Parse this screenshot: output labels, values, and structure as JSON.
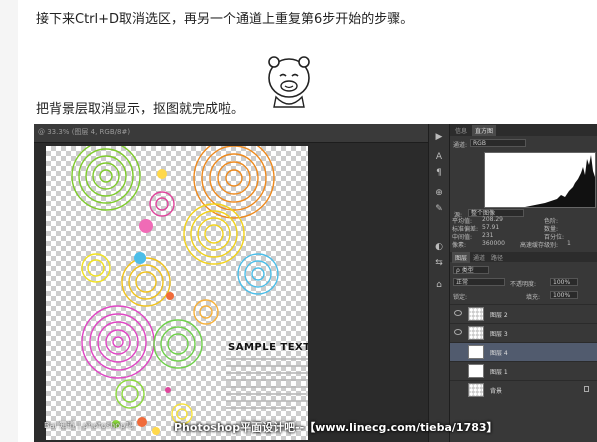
{
  "article": {
    "line1": "接下来Ctrl+D取消选区，再另一个通道上重复第6步开始的步骤。",
    "line2": "把背景层取消显示，抠图就完成啦。"
  },
  "photoshop": {
    "document_tab": "@ 33.3% (图层 4, RGB/8#)",
    "canvas": {
      "sample_text": "SAMPLE TEXT"
    },
    "tools": [
      "▶",
      "A",
      "¶",
      "⊕",
      "✎",
      "◐",
      "⇆",
      "⌂"
    ],
    "histogram_panel": {
      "tabs": [
        "信息",
        "直方图"
      ],
      "channel_label": "通道:",
      "channel_value": "RGB",
      "source_label": "源:",
      "source_value": "整个图像",
      "stats_left": [
        {
          "label": "平均值:",
          "value": "208.29"
        },
        {
          "label": "标准偏差:",
          "value": "57.91"
        },
        {
          "label": "中间值:",
          "value": "231"
        },
        {
          "label": "像素:",
          "value": "360000"
        }
      ],
      "stats_right": [
        {
          "label": "色阶:",
          "value": ""
        },
        {
          "label": "数量:",
          "value": ""
        },
        {
          "label": "百分位:",
          "value": ""
        },
        {
          "label": "高速缓存级别:",
          "value": "1"
        }
      ]
    },
    "layers_panel": {
      "tabs": [
        "图层",
        "通道",
        "路径"
      ],
      "kind_label": "ρ 类型",
      "blend_mode": "正常",
      "opacity_label": "不透明度:",
      "opacity_value": "100%",
      "lock_label": "锁定:",
      "fill_label": "填充:",
      "fill_value": "100%",
      "layers": [
        {
          "name": "图层 2",
          "visible": true,
          "selected": false,
          "thumb": "checker"
        },
        {
          "name": "图层 3",
          "visible": true,
          "selected": false,
          "thumb": "checker"
        },
        {
          "name": "图层 4",
          "visible": false,
          "selected": true,
          "thumb": "white"
        },
        {
          "name": "图层 1",
          "visible": false,
          "selected": false,
          "thumb": "white"
        },
        {
          "name": "背景",
          "visible": false,
          "selected": false,
          "thumb": "checker",
          "locked": true
        }
      ]
    }
  },
  "watermark": {
    "left": "Bai 知道 | photoshop吧",
    "right": "Photoshop平面设计吧--【www.linecg.com/tieba/1783】"
  }
}
